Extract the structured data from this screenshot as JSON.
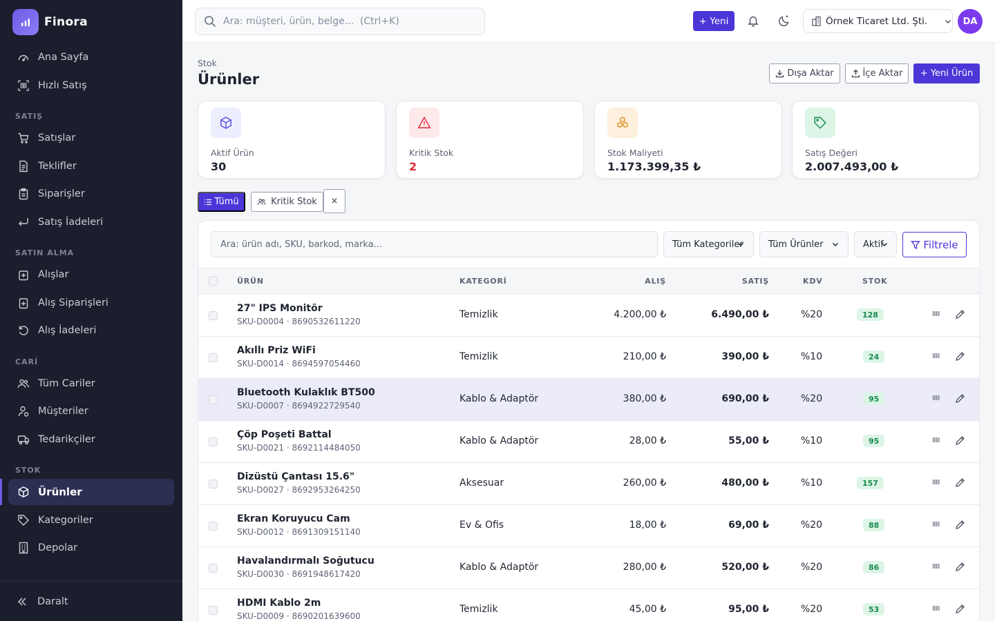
{
  "brand": {
    "name": "Finora"
  },
  "sidebar": {
    "top_items": [
      {
        "label": "Ana Sayfa",
        "icon": "gauge-icon"
      },
      {
        "label": "Hızlı Satış",
        "icon": "barcode-icon"
      }
    ],
    "sections": [
      {
        "title": "SATIŞ",
        "items": [
          {
            "label": "Satışlar",
            "icon": "cart-icon"
          },
          {
            "label": "Teklifler",
            "icon": "document-icon"
          },
          {
            "label": "Siparişler",
            "icon": "clipboard-icon"
          },
          {
            "label": "Satış İadeleri",
            "icon": "return-icon"
          }
        ]
      },
      {
        "title": "SATIN ALMA",
        "items": [
          {
            "label": "Alışlar",
            "icon": "bag-icon"
          },
          {
            "label": "Alış Siparişleri",
            "icon": "clipboard-plus-icon"
          },
          {
            "label": "Alış İadeleri",
            "icon": "undo-icon"
          }
        ]
      },
      {
        "title": "CARİ",
        "items": [
          {
            "label": "Tüm Cariler",
            "icon": "users-icon"
          },
          {
            "label": "Müşteriler",
            "icon": "user-icon"
          },
          {
            "label": "Tedarikçiler",
            "icon": "truck-icon"
          }
        ]
      },
      {
        "title": "STOK",
        "items": [
          {
            "label": "Ürünler",
            "icon": "box-icon",
            "active": true
          },
          {
            "label": "Kategoriler",
            "icon": "tag-icon"
          },
          {
            "label": "Depolar",
            "icon": "building-icon"
          }
        ]
      }
    ],
    "collapse_label": "Daralt"
  },
  "topbar": {
    "search_placeholder": "Ara: müşteri, ürün, belge...  (Ctrl+K)",
    "new_label": "+ Yeni",
    "company": "Örnek Ticaret Ltd. Şti.",
    "avatar": "DA"
  },
  "page": {
    "breadcrumb": "Stok",
    "title": "Ürünler",
    "export_label": "Dışa Aktar",
    "import_label": "İçe Aktar",
    "new_product_label": "+ Yeni Ürün"
  },
  "stats": [
    {
      "label": "Aktif Ürün",
      "value": "30",
      "icon": "box-icon",
      "color": "#1f2430",
      "bg": "#eceefe",
      "icolor": "#5b4ee0"
    },
    {
      "label": "Kritik Stok",
      "value": "2",
      "icon": "warning-icon",
      "color": "#d92d3a",
      "bg": "#fde8ea",
      "icolor": "#d92d3a"
    },
    {
      "label": "Stok Maliyeti",
      "value": "1.173.399,35 ₺",
      "icon": "boxes-icon",
      "color": "#1f2430",
      "bg": "#fdf0dc",
      "icolor": "#d98a18"
    },
    {
      "label": "Satış Değeri",
      "value": "2.007.493,00 ₺",
      "icon": "tag-icon",
      "color": "#1f2430",
      "bg": "#dcf5e7",
      "icolor": "#178a4e"
    }
  ],
  "chips": {
    "all": "Tümü",
    "critical": "Kritik Stok",
    "clear": "×"
  },
  "filters": {
    "search_placeholder": "Ara: ürün adı, SKU, barkod, marka...",
    "category": "Tüm Kategoriler",
    "products": "Tüm Ürünler",
    "status": "Aktif",
    "filter_label": "Filtrele"
  },
  "table": {
    "headers": {
      "product": "ÜRÜN",
      "category": "KATEGORİ",
      "buy": "ALIŞ",
      "sell": "SATIŞ",
      "vat": "KDV",
      "stock": "STOK"
    },
    "rows": [
      {
        "name": "27\" IPS Monitör",
        "sku": "SKU-D0004 · 8690532611220",
        "category": "Temizlik",
        "buy": "4.200,00 ₺",
        "sell": "6.490,00 ₺",
        "vat": "%20",
        "stock": "128"
      },
      {
        "name": "Akıllı Priz WiFi",
        "sku": "SKU-D0014 · 8694597054460",
        "category": "Temizlik",
        "buy": "210,00 ₺",
        "sell": "390,00 ₺",
        "vat": "%10",
        "stock": "24"
      },
      {
        "name": "Bluetooth Kulaklık BT500",
        "sku": "SKU-D0007 · 8694922729540",
        "category": "Kablo & Adaptör",
        "buy": "380,00 ₺",
        "sell": "690,00 ₺",
        "vat": "%20",
        "stock": "95"
      },
      {
        "name": "Çöp Poşeti Battal",
        "sku": "SKU-D0021 · 8692114484050",
        "category": "Kablo & Adaptör",
        "buy": "28,00 ₺",
        "sell": "55,00 ₺",
        "vat": "%10",
        "stock": "95"
      },
      {
        "name": "Dizüstü Çantası 15.6\"",
        "sku": "SKU-D0027 · 8692953264250",
        "category": "Aksesuar",
        "buy": "260,00 ₺",
        "sell": "480,00 ₺",
        "vat": "%10",
        "stock": "157"
      },
      {
        "name": "Ekran Koruyucu Cam",
        "sku": "SKU-D0012 · 8691309151140",
        "category": "Ev & Ofis",
        "buy": "18,00 ₺",
        "sell": "69,00 ₺",
        "vat": "%20",
        "stock": "88"
      },
      {
        "name": "Havalandırmalı Soğutucu",
        "sku": "SKU-D0030 · 8691948617420",
        "category": "Kablo & Adaptör",
        "buy": "280,00 ₺",
        "sell": "520,00 ₺",
        "vat": "%20",
        "stock": "86"
      },
      {
        "name": "HDMI Kablo 2m",
        "sku": "SKU-D0009 · 8690201639600",
        "category": "Temizlik",
        "buy": "45,00 ₺",
        "sell": "95,00 ₺",
        "vat": "%20",
        "stock": "53"
      }
    ]
  }
}
